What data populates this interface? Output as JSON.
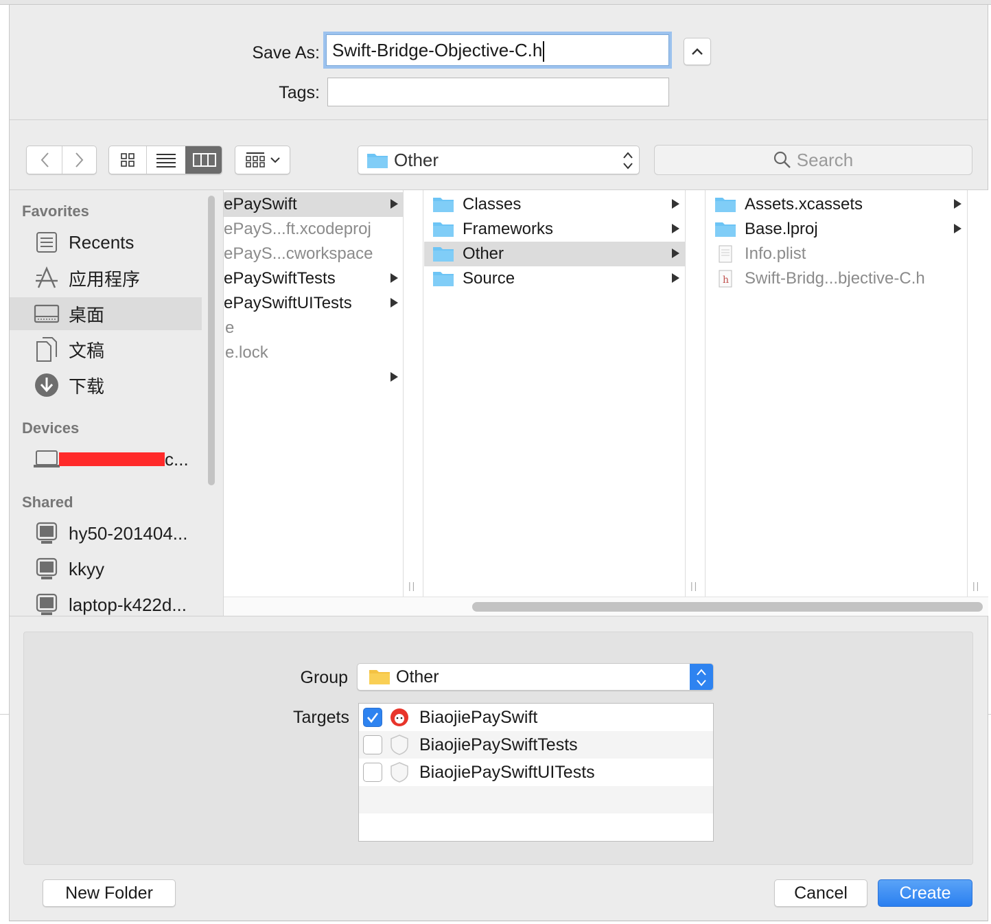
{
  "save_as": {
    "label": "Save As:",
    "value": "Swift-Bridge-Objective-C.h"
  },
  "tags": {
    "label": "Tags:",
    "value": ""
  },
  "toolbar": {
    "location": "Other",
    "search_placeholder": "Search",
    "view_modes": [
      "icon-view",
      "list-view",
      "column-view",
      "group-view"
    ],
    "active_view": "column-view"
  },
  "sidebar": {
    "favorites_header": "Favorites",
    "favorites": [
      {
        "label": "Recents",
        "icon": "recents-icon"
      },
      {
        "label": "应用程序",
        "icon": "applications-icon"
      },
      {
        "label": "桌面",
        "icon": "desktop-icon",
        "selected": true
      },
      {
        "label": "文稿",
        "icon": "documents-icon"
      },
      {
        "label": "下载",
        "icon": "downloads-icon"
      }
    ],
    "devices_header": "Devices",
    "device_label": "c...",
    "shared_header": "Shared",
    "shared": [
      {
        "label": "hy50-201404..."
      },
      {
        "label": "kkyy"
      },
      {
        "label": "laptop-k422d..."
      }
    ]
  },
  "columns": [
    {
      "items": [
        {
          "name": "ePaySwift",
          "arrow": true,
          "selected": true,
          "dim": false
        },
        {
          "name": "ePayS...ft.xcodeproj",
          "arrow": false,
          "dim": true
        },
        {
          "name": "ePayS...cworkspace",
          "arrow": false,
          "dim": true
        },
        {
          "name": "ePaySwiftTests",
          "arrow": true,
          "dim": false
        },
        {
          "name": "ePaySwiftUITests",
          "arrow": true,
          "dim": false
        },
        {
          "name": "e",
          "arrow": false,
          "dim": true
        },
        {
          "name": "e.lock",
          "arrow": false,
          "dim": true
        },
        {
          "name": "",
          "arrow": true,
          "dim": false
        }
      ]
    },
    {
      "items": [
        {
          "name": "Classes",
          "arrow": true
        },
        {
          "name": "Frameworks",
          "arrow": true
        },
        {
          "name": "Other",
          "arrow": true,
          "selected": true
        },
        {
          "name": "Source",
          "arrow": true
        }
      ]
    },
    {
      "items": [
        {
          "name": "Assets.xcassets",
          "arrow": true,
          "type": "folder"
        },
        {
          "name": "Base.lproj",
          "arrow": true,
          "type": "folder"
        },
        {
          "name": "Info.plist",
          "arrow": false,
          "type": "plist",
          "dim": true
        },
        {
          "name": "Swift-Bridg...bjective-C.h",
          "arrow": false,
          "type": "header",
          "dim": true
        }
      ]
    }
  ],
  "group": {
    "label": "Group",
    "value": "Other"
  },
  "targets": {
    "label": "Targets",
    "items": [
      {
        "name": "BiaojiePaySwift",
        "checked": true,
        "icon": "app-target-icon"
      },
      {
        "name": "BiaojiePaySwiftTests",
        "checked": false,
        "icon": "test-target-icon"
      },
      {
        "name": "BiaojiePaySwiftUITests",
        "checked": false,
        "icon": "test-target-icon"
      }
    ]
  },
  "buttons": {
    "new_folder": "New Folder",
    "cancel": "Cancel",
    "create": "Create"
  },
  "colors": {
    "accent": "#2e83f0",
    "folder": "#6cc4f5",
    "selection": "#dcdcdc",
    "redaction": "#ff2a2a"
  }
}
